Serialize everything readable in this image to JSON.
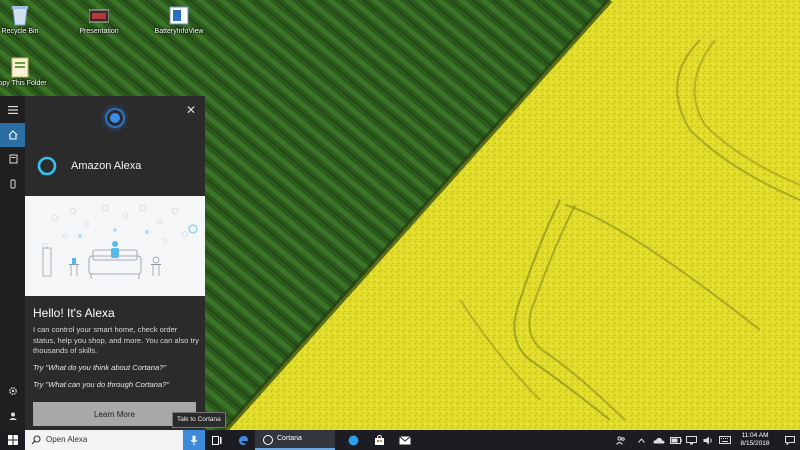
{
  "desktop": {
    "icons": [
      {
        "label": "Recycle Bin",
        "icon": "recycle-bin-icon"
      },
      {
        "label": "Presentation",
        "icon": "video-file-icon"
      },
      {
        "label": "BatteryInfoView",
        "icon": "app-window-icon"
      },
      {
        "label": "Copy This Folder",
        "icon": "folder-file-icon"
      }
    ]
  },
  "cortana": {
    "rail_icons": [
      "hamburger-menu-icon",
      "home-icon",
      "notebook-icon",
      "devices-icon",
      "settings-icon",
      "feedback-icon"
    ],
    "skill_title": "Amazon Alexa",
    "greeting": "Hello! It's Alexa",
    "description": "I can control your smart home, check order status, help you shop, and more. You can also try thousands of skills.",
    "try_1": "Try \"What do you think about Cortana?\"",
    "try_2": "Try \"What can you do through Cortana?\"",
    "learn_more": "Learn More",
    "tooltip": "Talk to Cortana"
  },
  "taskbar": {
    "search_text": "Open Alexa",
    "cortana_label": "Cortana",
    "time": "11:04 AM",
    "date": "8/15/2018",
    "accent": "#3c8ad8"
  }
}
